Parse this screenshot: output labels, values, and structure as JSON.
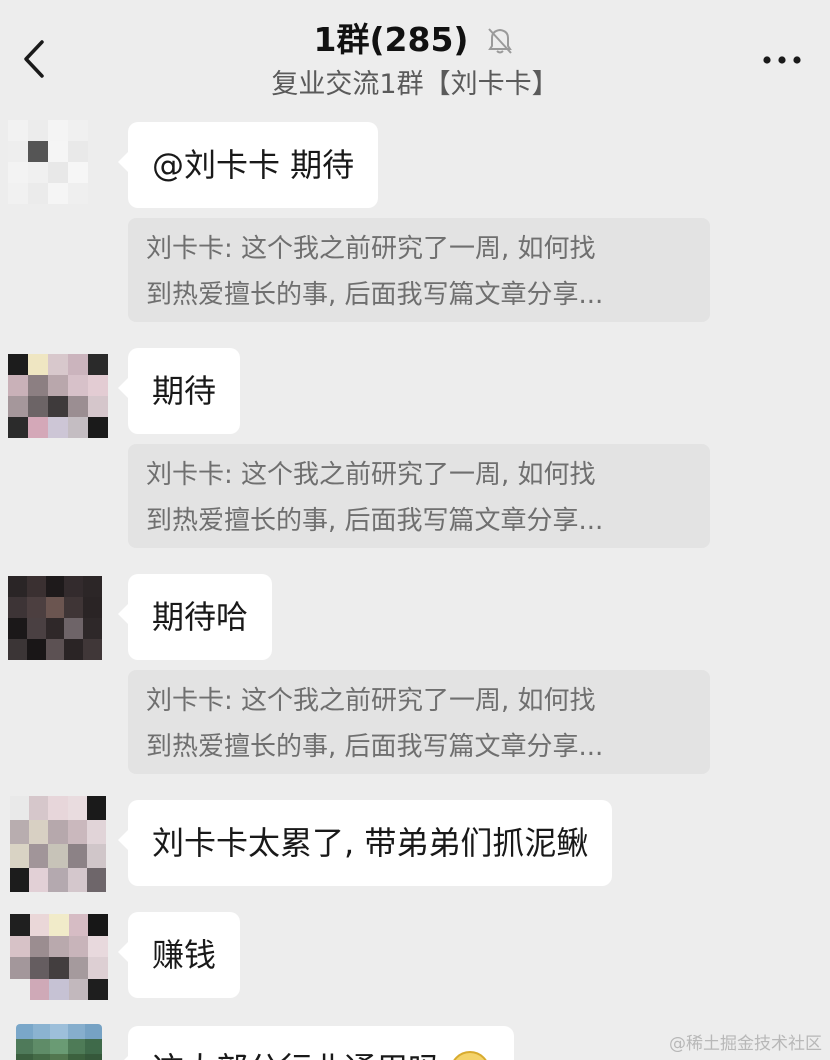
{
  "header": {
    "title": "1群(285)",
    "subtitle": "复业交流1群【刘卡卡】",
    "back_icon": "chevron-left-icon",
    "mute_icon": "bell-off-icon",
    "more_icon": "more-horizontal-icon"
  },
  "messages": [
    {
      "text": "@刘卡卡  期待",
      "quote": {
        "line1": "刘卡卡: 这个我之前研究了一周, 如何找",
        "line2": "到热爱擅长的事, 后面我写篇文章分享..."
      }
    },
    {
      "text": "期待",
      "quote": {
        "line1": "刘卡卡: 这个我之前研究了一周, 如何找",
        "line2": "到热爱擅长的事, 后面我写篇文章分享..."
      }
    },
    {
      "text": "期待哈",
      "quote": {
        "line1": "刘卡卡: 这个我之前研究了一周, 如何找",
        "line2": "到热爱擅长的事, 后面我写篇文章分享..."
      }
    },
    {
      "text": "刘卡卡太累了, 带弟弟们抓泥鳅"
    },
    {
      "text": "赚钱"
    },
    {
      "text": "这大部分行业通用吗"
    }
  ],
  "watermark": "@稀土掘金技术社区",
  "colors": {
    "background": "#ededed",
    "bubble": "#ffffff",
    "quote_bg": "#e3e3e3"
  }
}
